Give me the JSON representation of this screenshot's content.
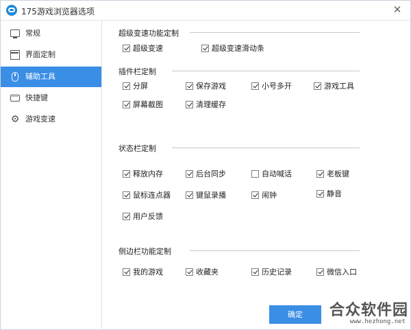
{
  "window": {
    "title": "175游戏浏览器选项"
  },
  "sidebar": {
    "items": [
      {
        "label": "常规",
        "icon": "monitor-icon",
        "active": false
      },
      {
        "label": "界面定制",
        "icon": "window-icon",
        "active": false
      },
      {
        "label": "辅助工具",
        "icon": "mouse-icon",
        "active": true
      },
      {
        "label": "快捷键",
        "icon": "keyboard-icon",
        "active": false
      },
      {
        "label": "游戏变速",
        "icon": "gear-icon",
        "active": false
      }
    ]
  },
  "sections": {
    "speed": {
      "title": "超级变速功能定制",
      "options": [
        {
          "label": "超级变速",
          "checked": true
        },
        {
          "label": "超级变速滑动条",
          "checked": true
        }
      ]
    },
    "plugin": {
      "title": "插件栏定制",
      "options": [
        {
          "label": "分屏",
          "checked": true
        },
        {
          "label": "保存游戏",
          "checked": true
        },
        {
          "label": "小号多开",
          "checked": true
        },
        {
          "label": "游戏工具",
          "checked": true
        },
        {
          "label": "屏幕截图",
          "checked": true
        },
        {
          "label": "清理缓存",
          "checked": true
        }
      ]
    },
    "status": {
      "title": "状态栏定制",
      "options": [
        {
          "label": "释放内存",
          "checked": true
        },
        {
          "label": "后台同步",
          "checked": true
        },
        {
          "label": "自动喊话",
          "checked": false
        },
        {
          "label": "老板键",
          "checked": true
        },
        {
          "label": "鼠标连点器",
          "checked": true
        },
        {
          "label": "键鼠录播",
          "checked": true
        },
        {
          "label": "闹钟",
          "checked": true
        },
        {
          "label": "静音",
          "checked": true
        },
        {
          "label": "用户反馈",
          "checked": true
        }
      ]
    },
    "side": {
      "title": "侧边栏功能定制",
      "options": [
        {
          "label": "我的游戏",
          "checked": true
        },
        {
          "label": "收藏夹",
          "checked": true
        },
        {
          "label": "历史记录",
          "checked": true
        },
        {
          "label": "微信入口",
          "checked": true
        }
      ]
    }
  },
  "footer": {
    "ok_label": "确定"
  },
  "watermark": {
    "text": "合众软件园",
    "url": "www.hezhong.net"
  },
  "colors": {
    "accent": "#3a8ee6",
    "border": "#c9d3dd"
  }
}
